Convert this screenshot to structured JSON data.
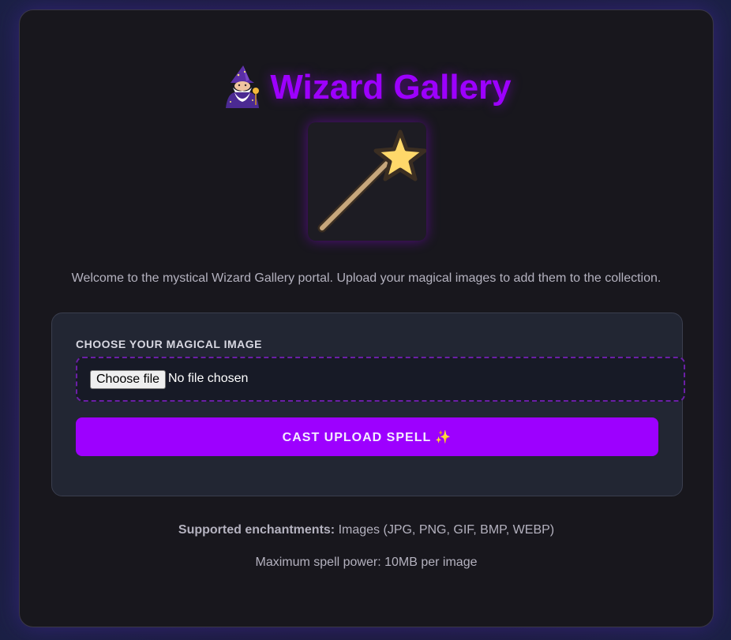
{
  "app": {
    "title": "Wizard Gallery",
    "title_icon": "wizard-icon",
    "hero_icon": "magic-wand-icon",
    "accent_color": "#9d00ff"
  },
  "intro": {
    "text": "Welcome to the mystical Wizard Gallery portal. Upload your magical images to add them to the collection."
  },
  "upload_form": {
    "label": "CHOOSE YOUR MAGICAL IMAGE",
    "file_input": {
      "button_label": "Choose file",
      "status": "No file chosen"
    },
    "submit_label": "CAST UPLOAD SPELL ✨"
  },
  "info": {
    "supported_label": "Supported enchantments:",
    "supported_value": " Images (JPG, PNG, GIF, BMP, WEBP)",
    "max_size": "Maximum spell power: 10MB per image"
  }
}
